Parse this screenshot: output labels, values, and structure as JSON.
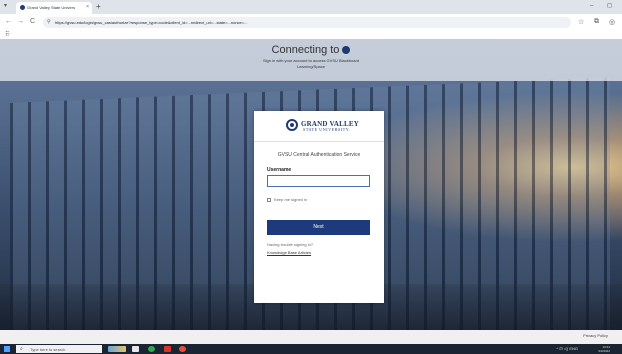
{
  "browser": {
    "tab_title": "Grand Valley State Univers",
    "tab_close": "×",
    "new_tab": "+",
    "tab_menu": "▾",
    "window_controls": "–  ◻",
    "nav_back": "←",
    "nav_forward": "→",
    "nav_reload": "C",
    "url": "https://gvsu.edu/login/gvsu_cas/authorize?response_type=code&client_id=...redirect_uri=...state=...nonce=...",
    "star": "☆",
    "extensions": "⧉",
    "profile": "◎",
    "apps": "⠿"
  },
  "header": {
    "title": "Connecting to",
    "subtitle": "Sign in with your account to access GVSU Blackboard Learning/Space"
  },
  "card": {
    "brand_line1": "GRAND VALLEY",
    "brand_line2": "STATE UNIVERSITY.",
    "service": "GVSU Central Authentication Service",
    "username_label": "Username",
    "username_value": "",
    "keep_signed_in": "Keep me signed in",
    "next_button": "Next",
    "trouble": "Having trouble signing in?",
    "kb_link": "Knowledge Base Articles"
  },
  "footer": {
    "privacy": "Privacy Policy"
  },
  "taskbar": {
    "search_placeholder": "Type here to search",
    "search_icon": "⌕",
    "tray_icons": "^ ⊡ ◁) ENG",
    "time": "10:44",
    "date": "9/2/2022"
  },
  "colors": {
    "brand_navy": "#1e3a70",
    "button_blue": "#1d3a7d",
    "taskbar": "#1b2433"
  }
}
